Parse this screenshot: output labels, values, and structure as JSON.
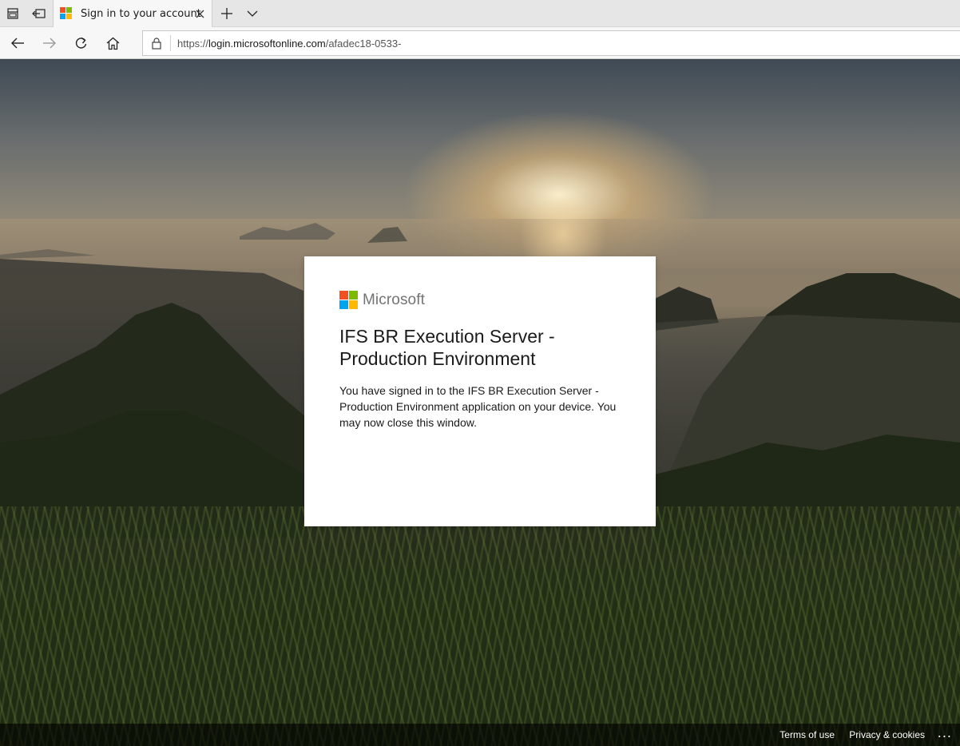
{
  "browser": {
    "tab": {
      "title": "Sign in to your account",
      "favicon_icon": "microsoft-logo-icon"
    },
    "tab_bar_icons": [
      "tab-preview-icon",
      "set-aside-tabs-icon",
      "close-icon",
      "new-tab-icon",
      "tab-list-chevron-icon"
    ],
    "nav_icons": [
      "back-arrow-icon",
      "forward-arrow-icon",
      "refresh-icon",
      "home-icon",
      "lock-icon"
    ],
    "address": {
      "url_prefix": "https://",
      "url_host": "login.microsoftonline.com",
      "url_path": "/afadec18-0533-"
    }
  },
  "card": {
    "brand_word": "Microsoft",
    "logo_colors": [
      "#f25022",
      "#7fba00",
      "#00a4ef",
      "#ffb900"
    ],
    "title": "IFS BR Execution Server - Production Environment",
    "message": "You have signed in to the IFS BR Execution Server - Production Environment application on your device. You may now close this window."
  },
  "footer": {
    "terms_label": "Terms of use",
    "privacy_label": "Privacy & cookies",
    "more_label": "..."
  }
}
